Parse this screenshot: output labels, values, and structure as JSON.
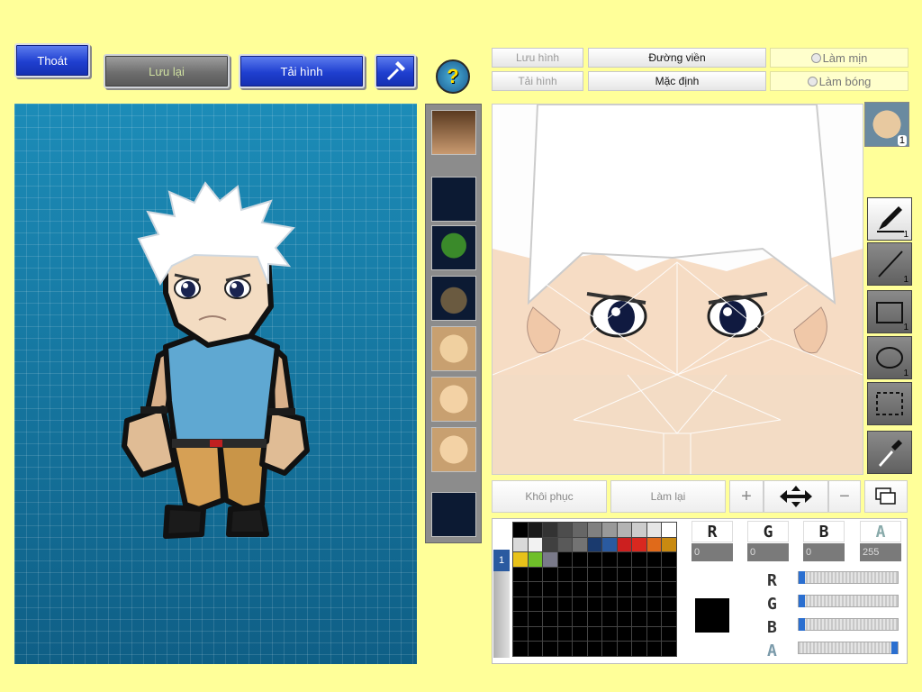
{
  "toolbar": {
    "exit_label": "Thoát",
    "save_label": "Lưu lại",
    "reload_label": "Tải hình",
    "help_symbol": "?"
  },
  "editor": {
    "save_image_label": "Lưu hình",
    "outline_label": "Đường viền",
    "smooth_label": "Làm mịn",
    "load_image_label": "Tải hình",
    "default_label": "Mặc định",
    "shine_label": "Làm bóng",
    "restore_label": "Khôi phục",
    "redo_label": "Làm lại"
  },
  "tools": {
    "brush_count": "1",
    "line_count": "1",
    "rect_count": "1",
    "ellipse_count": "1",
    "layer_badge": "1"
  },
  "color": {
    "r_label": "R",
    "g_label": "G",
    "b_label": "B",
    "a_label": "A",
    "r_value": "0",
    "g_value": "0",
    "b_value": "0",
    "a_value": "255",
    "current_hex": "#000000",
    "layer_tab": "1"
  },
  "palette_colors": [
    "#000000",
    "#1a1a1a",
    "#333333",
    "#4d4d4d",
    "#666666",
    "#808080",
    "#999999",
    "#b3b3b3",
    "#cccccc",
    "#e6e6e6",
    "#ffffff",
    "#d9d9d9",
    "#f2f2f2",
    "#404040",
    "#595959",
    "#737373",
    "#1a3a6e",
    "#2a5aa0",
    "#cc1f1f",
    "#d9281f",
    "#e06a1a",
    "#c98a10",
    "#e8c21a",
    "#6fbf2a",
    "#7a7a8a"
  ],
  "sliders": {
    "r": 0.0,
    "g": 0.0,
    "b": 0.0,
    "a": 1.0
  }
}
